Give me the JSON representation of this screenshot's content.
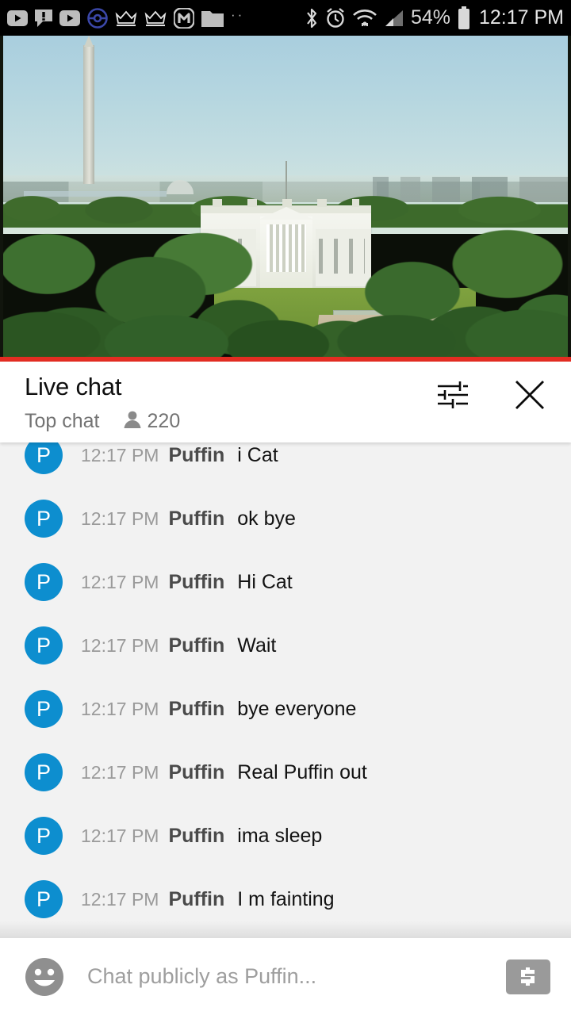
{
  "status_bar": {
    "notification_icons": [
      {
        "name": "youtube-icon",
        "glyph": "▶"
      },
      {
        "name": "comment-alert-icon",
        "glyph": "!"
      },
      {
        "name": "youtube-secondary-icon",
        "glyph": "▶"
      },
      {
        "name": "pokeball-icon",
        "glyph": "●"
      },
      {
        "name": "crown-icon-1",
        "glyph": "♛"
      },
      {
        "name": "crown-icon-2",
        "glyph": "♛"
      },
      {
        "name": "musically-icon",
        "glyph": "M"
      },
      {
        "name": "folder-icon",
        "glyph": "▰"
      }
    ],
    "more_indicator": "··",
    "bluetooth_icon": "bluetooth-icon",
    "alarm_icon": "alarm-clock-icon",
    "wifi_icon": "wifi-icon",
    "signal_icon": "cell-signal-icon",
    "battery_percent": "54%",
    "battery_icon": "battery-icon",
    "clock": "12:17 PM"
  },
  "player": {
    "scene_description": "White House with Washington Monument live stream",
    "progress_color": "#e42d22",
    "progress_percent": 100
  },
  "chat_header": {
    "title": "Live chat",
    "mode": "Top chat",
    "viewer_icon": "person-icon",
    "viewer_count": "220",
    "filter_icon": "tune-icon",
    "close_icon": "close-icon"
  },
  "accent_colors": {
    "avatar_blue": "#0d8ecf",
    "youtube_red": "#e42d22",
    "list_background": "#f2f2f2"
  },
  "messages": [
    {
      "avatar": "P",
      "time": "12:17 PM",
      "author": "Puffin",
      "text": "i Cat"
    },
    {
      "avatar": "P",
      "time": "12:17 PM",
      "author": "Puffin",
      "text": "ok bye"
    },
    {
      "avatar": "P",
      "time": "12:17 PM",
      "author": "Puffin",
      "text": "Hi Cat"
    },
    {
      "avatar": "P",
      "time": "12:17 PM",
      "author": "Puffin",
      "text": "Wait"
    },
    {
      "avatar": "P",
      "time": "12:17 PM",
      "author": "Puffin",
      "text": "bye everyone"
    },
    {
      "avatar": "P",
      "time": "12:17 PM",
      "author": "Puffin",
      "text": "Real Puffin out"
    },
    {
      "avatar": "P",
      "time": "12:17 PM",
      "author": "Puffin",
      "text": "ima sleep"
    },
    {
      "avatar": "P",
      "time": "12:17 PM",
      "author": "Puffin",
      "text": "I m fainting"
    }
  ],
  "input_bar": {
    "emoji_icon": "emoji-smiley-icon",
    "placeholder": "Chat publicly as Puffin...",
    "value": "",
    "superchat_icon": "dollar-sign-icon"
  }
}
